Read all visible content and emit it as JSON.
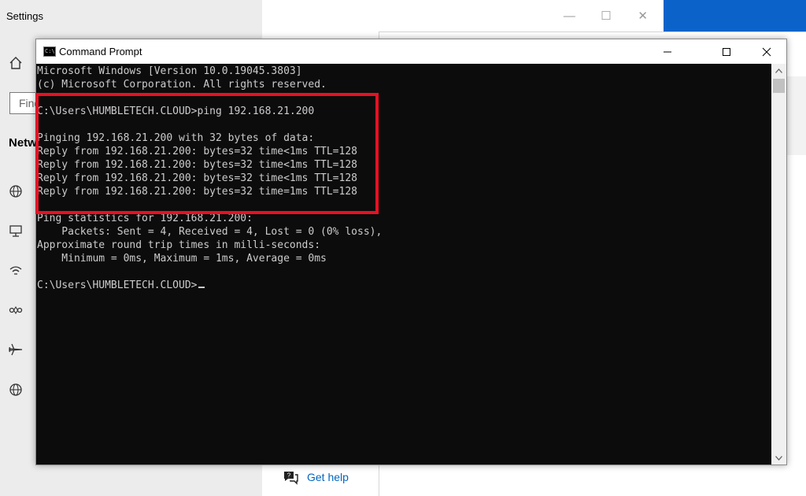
{
  "settings": {
    "title": "Settings",
    "search_placeholder": "Find",
    "section_heading": "Network & Internet",
    "help_link": "Get help"
  },
  "cmd": {
    "title": "Command Prompt",
    "lines": [
      "Microsoft Windows [Version 10.0.19045.3803]",
      "(c) Microsoft Corporation. All rights reserved.",
      "",
      "C:\\Users\\HUMBLETECH.CLOUD>ping 192.168.21.200",
      "",
      "Pinging 192.168.21.200 with 32 bytes of data:",
      "Reply from 192.168.21.200: bytes=32 time<1ms TTL=128",
      "Reply from 192.168.21.200: bytes=32 time<1ms TTL=128",
      "Reply from 192.168.21.200: bytes=32 time<1ms TTL=128",
      "Reply from 192.168.21.200: bytes=32 time=1ms TTL=128",
      "",
      "Ping statistics for 192.168.21.200:",
      "    Packets: Sent = 4, Received = 4, Lost = 0 (0% loss),",
      "Approximate round trip times in milli-seconds:",
      "    Minimum = 0ms, Maximum = 1ms, Average = 0ms",
      "",
      "C:\\Users\\HUMBLETECH.CLOUD>"
    ]
  },
  "colors": {
    "console_bg": "#0c0c0c",
    "console_text": "#cccccc",
    "highlight": "#e81123",
    "link": "#0067c0",
    "desktop_accent": "#0b63c9"
  },
  "icons": {
    "settings_sidebar": [
      "home-icon",
      "globe-icon",
      "ethernet-icon",
      "dialup-icon",
      "vpn-icon",
      "airplane-icon",
      "proxy-globe-icon"
    ],
    "cmd_controls": [
      "minimize-icon",
      "maximize-icon",
      "close-icon"
    ],
    "help": "help-chat-icon"
  }
}
